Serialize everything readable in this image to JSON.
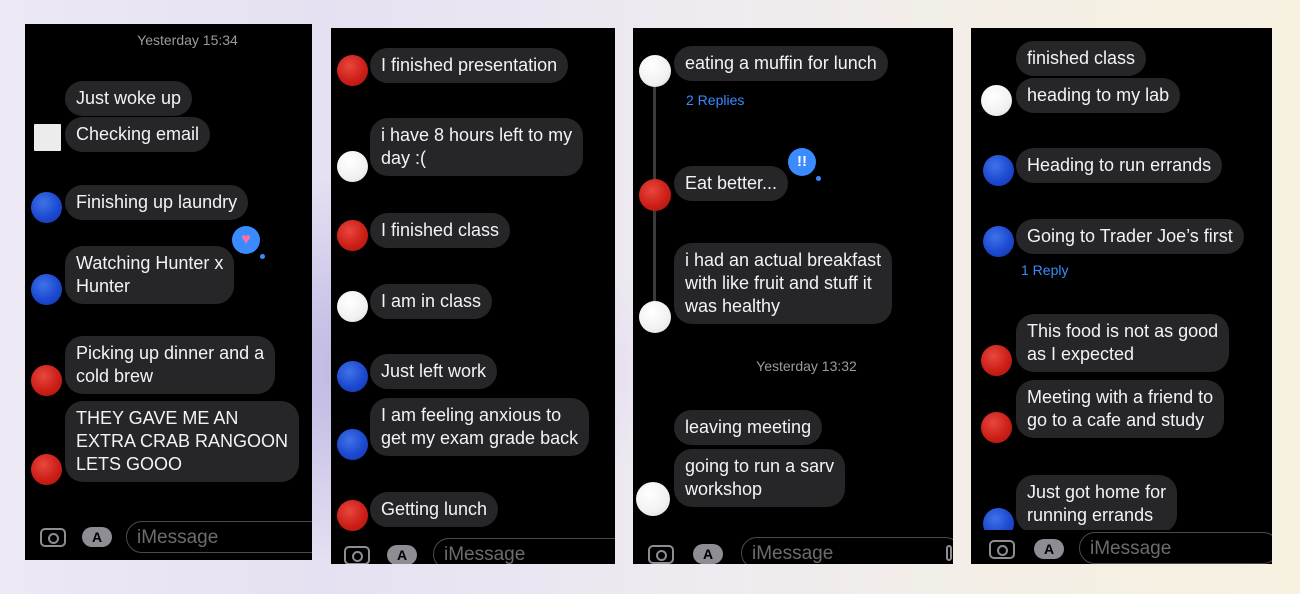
{
  "input_placeholder": "iMessage",
  "colors": {
    "bubble": "#262628",
    "text": "#f2f2f7",
    "link": "#3a8bff",
    "red": "#cc1f17",
    "blue": "#1c49d0"
  },
  "panel1": {
    "timestamp": "Yesterday 15:34",
    "messages": [
      "Just woke up",
      "Checking email",
      "Finishing up laundry",
      "Watching Hunter x\nHunter",
      "Picking up dinner and a\ncold brew",
      "THEY GAVE ME AN\nEXTRA CRAB RANGOON\nLETS GOOO"
    ],
    "reaction": "heart"
  },
  "panel2": {
    "messages": [
      "I finished presentation",
      "i have 8 hours left to my\nday :(",
      "I finished class",
      "I am in class",
      "Just left work",
      "I am feeling anxious to\nget my exam grade back",
      "Getting lunch"
    ]
  },
  "panel3": {
    "messages": [
      "eating a muffin for lunch",
      "Eat better...",
      "i had an actual breakfast\nwith like fruit and stuff it\nwas healthy",
      "leaving meeting",
      "going to run a sarv\nworkshop"
    ],
    "replies": "2 Replies",
    "timestamp": "Yesterday 13:32",
    "reaction": "!!"
  },
  "panel4": {
    "messages": [
      "finished class",
      "heading to my lab",
      "Heading to run errands",
      "Going to Trader Joe’s first",
      "This food is not as good\nas I expected",
      "Meeting with a friend to\ngo to a cafe and study",
      "Just got home for\nrunning errands"
    ],
    "replies": "1 Reply"
  }
}
